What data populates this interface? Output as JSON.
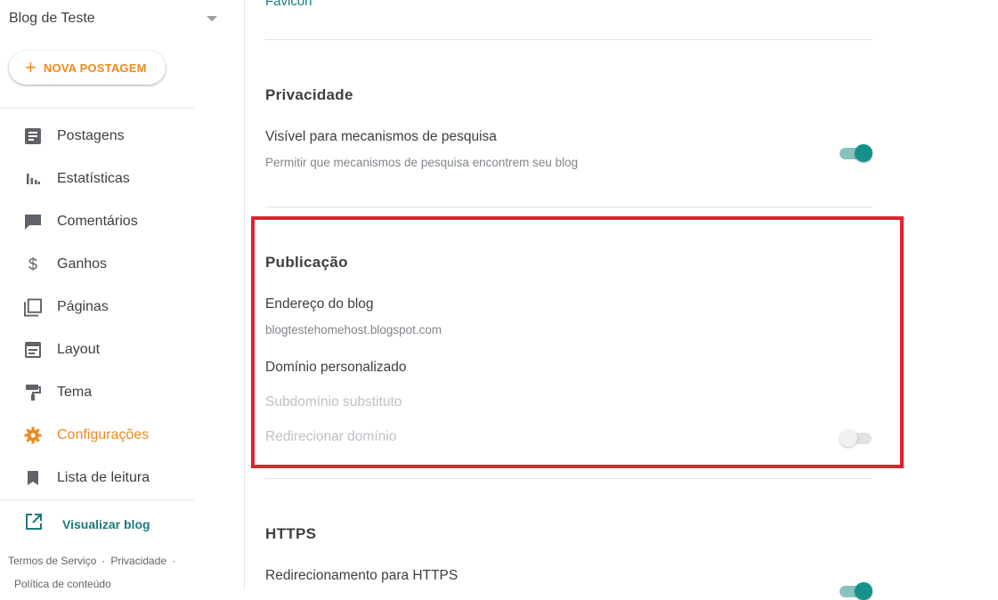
{
  "sidebar": {
    "blog_name": "Blog de Teste",
    "new_post_label": "NOVA POSTAGEM",
    "items": [
      {
        "label": "Postagens",
        "icon": "posts-icon"
      },
      {
        "label": "Estatísticas",
        "icon": "stats-icon"
      },
      {
        "label": "Comentários",
        "icon": "comments-icon"
      },
      {
        "label": "Ganhos",
        "icon": "dollar-icon"
      },
      {
        "label": "Páginas",
        "icon": "pages-icon"
      },
      {
        "label": "Layout",
        "icon": "layout-icon"
      },
      {
        "label": "Tema",
        "icon": "paint-roller-icon"
      },
      {
        "label": "Configurações",
        "icon": "gear-icon"
      },
      {
        "label": "Lista de leitura",
        "icon": "bookmark-icon"
      }
    ],
    "view_blog_label": "Visualizar blog",
    "footer": {
      "terms": "Termos de Serviço",
      "privacy": "Privacidade",
      "content_policy": "Política de conteúdo",
      "separator": "·"
    }
  },
  "main": {
    "favicon_label": "Favicon",
    "privacy": {
      "title": "Privacidade",
      "visible_label": "Visível para mecanismos de pesquisa",
      "visible_sub": "Permitir que mecanismos de pesquisa encontrem seu blog"
    },
    "publication": {
      "title": "Publicação",
      "address_label": "Endereço do blog",
      "address_value": "blogtestehomehost.blogspot.com",
      "custom_domain_label": "Domínio personalizado",
      "substitute_subdomain_label": "Subdomínio substituto",
      "redirect_domain_label": "Redirecionar domínio"
    },
    "https": {
      "title": "HTTPS",
      "redirect_label": "Redirecionamento para HTTPS"
    }
  },
  "colors": {
    "accent_orange": "#ef8a1c",
    "accent_teal": "#14918a",
    "highlight_red": "#e4202d"
  }
}
